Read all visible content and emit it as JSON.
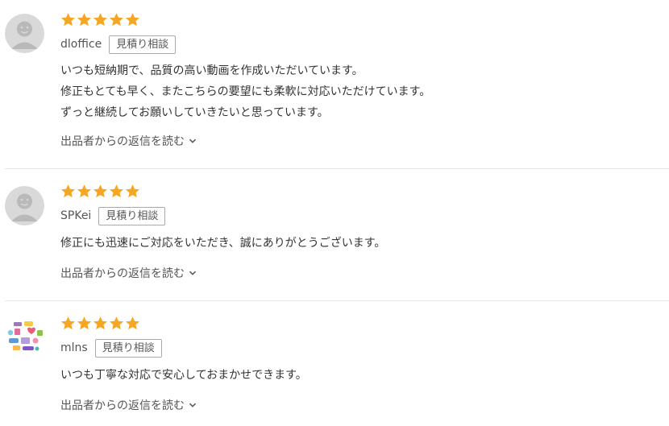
{
  "colors": {
    "star": "#f5a623",
    "divider": "#e6e6e6"
  },
  "reviews": [
    {
      "rating": 5,
      "username": "dloffice",
      "badge": "見積り相談",
      "avatar_icon": "default-user-icon",
      "comment": [
        "いつも短納期で、品質の高い動画を作成いただいています。",
        "修正もとても早く、またこちらの要望にも柔軟に対応いただけています。",
        "ずっと継続してお願いしていきたいと思っています。"
      ],
      "reply_link": "出品者からの返信を読む"
    },
    {
      "rating": 5,
      "username": "SPKei",
      "badge": "見積り相談",
      "avatar_icon": "default-user-icon",
      "comment": [
        "修正にも迅速にご対応をいただき、誠にありがとうございます。"
      ],
      "reply_link": "出品者からの返信を読む"
    },
    {
      "rating": 5,
      "username": "mlns",
      "badge": "見積り相談",
      "avatar_icon": "sticker-collage-avatar",
      "comment": [
        "いつも丁寧な対応で安心しておまかせできます。"
      ],
      "reply_link": "出品者からの返信を読む"
    }
  ]
}
